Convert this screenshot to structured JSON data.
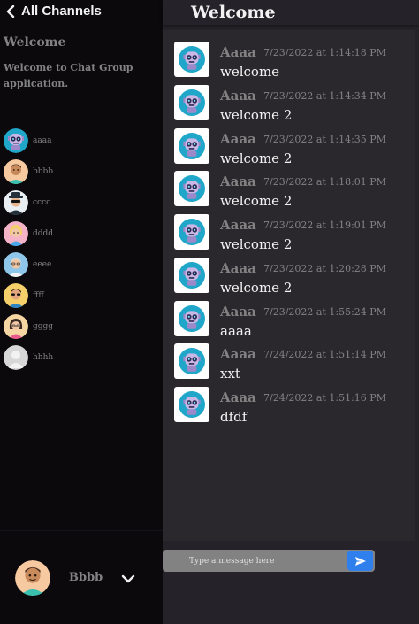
{
  "sidebar": {
    "header_title": "All Channels",
    "channel": {
      "name": "Welcome",
      "description": "Welcome to Chat Group application."
    },
    "members": [
      {
        "name": "aaaa",
        "avatar": "robot-avatar-icon"
      },
      {
        "name": "bbbb",
        "avatar": "man-avatar-icon"
      },
      {
        "name": "cccc",
        "avatar": "spy-avatar-icon"
      },
      {
        "name": "dddd",
        "avatar": "woman-avatar-icon"
      },
      {
        "name": "eeee",
        "avatar": "old-man-avatar-icon"
      },
      {
        "name": "ffff",
        "avatar": "sunglasses-avatar-icon"
      },
      {
        "name": "gggg",
        "avatar": "girl-avatar-icon"
      },
      {
        "name": "hhhh",
        "avatar": "default-avatar-icon"
      }
    ],
    "current_user": {
      "name": "Bbbb",
      "avatar": "man-avatar-icon"
    }
  },
  "main": {
    "title": "Welcome",
    "messages": [
      {
        "author": "Aaaa",
        "time": "7/23/2022 at 1:14:18 PM",
        "text": "welcome"
      },
      {
        "author": "Aaaa",
        "time": "7/23/2022 at 1:14:34 PM",
        "text": "welcome 2"
      },
      {
        "author": "Aaaa",
        "time": "7/23/2022 at 1:14:35 PM",
        "text": "welcome 2"
      },
      {
        "author": "Aaaa",
        "time": "7/23/2022 at 1:18:01 PM",
        "text": "welcome 2"
      },
      {
        "author": "Aaaa",
        "time": "7/23/2022 at 1:19:01 PM",
        "text": "welcome 2"
      },
      {
        "author": "Aaaa",
        "time": "7/23/2022 at 1:20:28 PM",
        "text": "welcome 2"
      },
      {
        "author": "Aaaa",
        "time": "7/23/2022 at 1:55:24 PM",
        "text": "aaaa"
      },
      {
        "author": "Aaaa",
        "time": "7/24/2022 at 1:51:14 PM",
        "text": "xxt"
      },
      {
        "author": "Aaaa",
        "time": "7/24/2022 at 1:51:16 PM",
        "text": "dfdf"
      }
    ],
    "composer": {
      "placeholder": "Type a message here",
      "value": ""
    }
  },
  "colors": {
    "sidebar_bg": "#0b090c",
    "main_bg": "#252329",
    "messages_bg": "#2a282d",
    "muted_text": "#828282",
    "light_text": "#f2f2f2",
    "accent": "#2f80ed"
  },
  "icons": {
    "back": "chevron-left-icon",
    "user_menu": "chevron-down-icon",
    "send": "send-icon"
  }
}
